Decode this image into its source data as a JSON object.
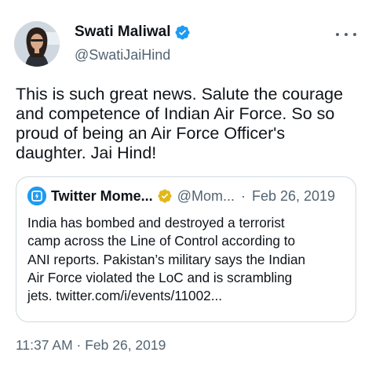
{
  "author": {
    "display_name": "Swati Maliwal",
    "handle": "@SwatiJaiHind",
    "verified": true
  },
  "more_icon": "more-horizontal-icon",
  "tweet": {
    "text": "This is such great news. Salute the courage\nand competence of Indian Air Force. So so\nproud of being an Air Force Officer's\ndaughter. Jai Hind!",
    "time": "11:37 AM",
    "separator": "·",
    "date": "Feb 26, 2019"
  },
  "quoted_tweet": {
    "display_name": "Twitter Mome...",
    "handle": "@Mom...",
    "separator": "·",
    "date": "Feb 26, 2019",
    "verified_badge": "gold",
    "text": "India has bombed and destroyed a terrorist\ncamp across the Line of Control according to\nANI reports. Pakistan’s military says the Indian\nAir Force violated the LoC and is scrambling\njets. twitter.com/i/events/11002..."
  },
  "colors": {
    "text_primary": "#0f1419",
    "text_secondary": "#536471",
    "verified_blue": "#1d9bf0",
    "verified_gold": "#e2b719",
    "border": "#cfd9de"
  }
}
